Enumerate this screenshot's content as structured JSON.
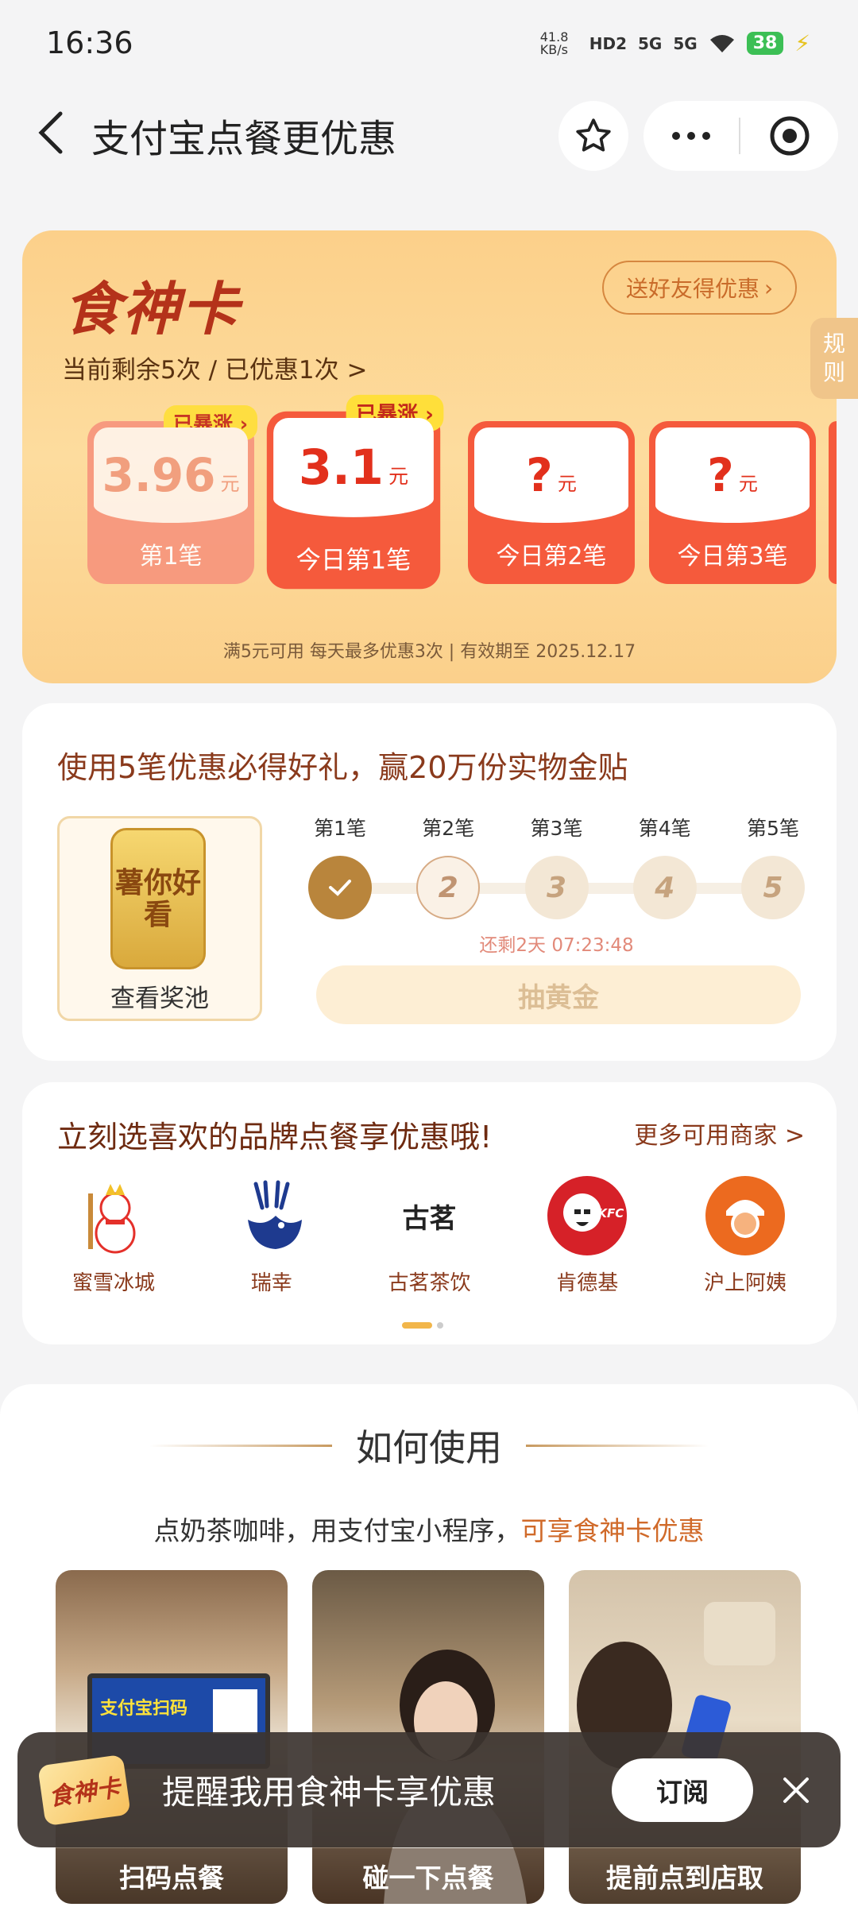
{
  "status": {
    "time": "16:36",
    "net_speed": "41.8 KB/s",
    "hd": "HD2",
    "sig1": "5G",
    "sig2": "5G",
    "battery": "38"
  },
  "nav": {
    "title": "支付宝点餐更优惠"
  },
  "card": {
    "logo": "食神卡",
    "share": "送好友得优惠",
    "remain": "当前剩余5次 / 已优惠1次 >",
    "rule": [
      "规",
      "则"
    ],
    "tickets": [
      {
        "amount": "3.96",
        "unit": "元",
        "label": "第1笔",
        "badge": "已暴涨"
      },
      {
        "amount": "3.1",
        "unit": "元",
        "label": "今日第1笔",
        "badge": "已暴涨"
      },
      {
        "amount": "?",
        "unit": "元",
        "label": "今日第2笔"
      },
      {
        "amount": "?",
        "unit": "元",
        "label": "今日第3笔"
      }
    ],
    "note": "满5元可用  每天最多优惠3次 | 有效期至 2025.12.17"
  },
  "gift": {
    "heading": "使用5笔优惠必得好礼，赢20万份实物金贴",
    "pool_tag": "薯你好看",
    "pool_label": "查看奖池",
    "steps": [
      "第1笔",
      "第2笔",
      "第3笔",
      "第4笔",
      "第5笔"
    ],
    "step_nums": [
      "",
      "2",
      "3",
      "4",
      "5"
    ],
    "countdown": "还剩2天 07:23:48",
    "draw": "抽黄金"
  },
  "brands": {
    "heading": "立刻选喜欢的品牌点餐享优惠哦!",
    "more": "更多可用商家 >",
    "items": [
      {
        "name": "蜜雪冰城"
      },
      {
        "name": "瑞幸"
      },
      {
        "name": "古茗茶饮",
        "logo_text": "古茗"
      },
      {
        "name": "肯德基",
        "logo_text": "KFC"
      },
      {
        "name": "沪上阿姨"
      }
    ]
  },
  "howto": {
    "title": "如何使用",
    "sub_prefix": "点奶茶咖啡，用支付宝小程序，",
    "sub_highlight": "可享食神卡优惠",
    "screen_text": "支付宝扫码",
    "cards": [
      "扫码点餐",
      "碰一下点餐",
      "提前点到店取"
    ]
  },
  "subscribe": {
    "logo": "食神卡",
    "message": "提醒我用食神卡享优惠",
    "button": "订阅"
  },
  "colors": {
    "accent": "#f55a3c",
    "gold": "#b9853c",
    "card_bg": "#fcd08a"
  }
}
